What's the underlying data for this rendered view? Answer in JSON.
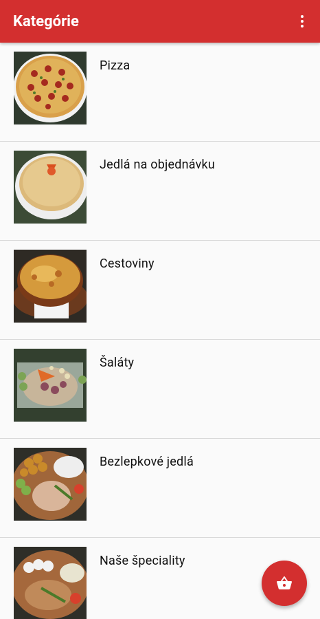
{
  "appbar": {
    "title": "Kategórie",
    "menu_icon": "more-vert-icon"
  },
  "categories": [
    {
      "label": "Pizza",
      "icon": "pizza-photo"
    },
    {
      "label": "Jedlá na objednávku",
      "icon": "omelette-photo"
    },
    {
      "label": "Cestoviny",
      "icon": "baked-pasta-photo"
    },
    {
      "label": "Šaláty",
      "icon": "salad-photo"
    },
    {
      "label": "Bezlepkové jedlá",
      "icon": "gluten-free-plate-photo"
    },
    {
      "label": "Naše špeciality",
      "icon": "specialty-plate-photo"
    }
  ],
  "fab": {
    "icon": "shopping-basket-icon"
  },
  "colors": {
    "primary": "#d32f2f",
    "background": "#fafafa",
    "divider": "#d9d9d9"
  }
}
